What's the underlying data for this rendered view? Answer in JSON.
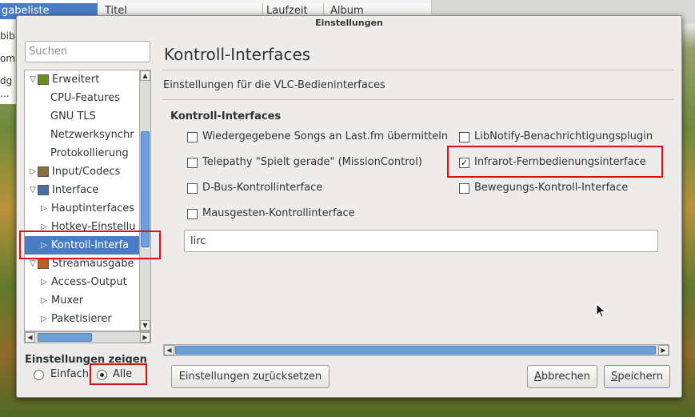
{
  "background_window": {
    "playlist_tab": "gabeliste",
    "sidebar_fragments": [
      "bib",
      "om",
      "dg",
      "..."
    ],
    "columns": [
      "Titel",
      "Laufzeit",
      "Album"
    ]
  },
  "dialog": {
    "title": "Einstellungen",
    "search_placeholder": "Suchen",
    "tree": [
      {
        "label": "Erweitert",
        "expander": "▽",
        "icon": "chip"
      },
      {
        "label": "CPU-Features"
      },
      {
        "label": "GNU TLS"
      },
      {
        "label": "Netzwerksynchr"
      },
      {
        "label": "Protokollierung"
      },
      {
        "label": "Input/Codecs",
        "expander": "▷",
        "icon": "codec"
      },
      {
        "label": "Interface",
        "expander": "▽",
        "icon": "interface"
      },
      {
        "label": "Hauptinterfaces",
        "expander": "▷"
      },
      {
        "label": "Hotkey-Einstellu",
        "expander": "▷"
      },
      {
        "label": "Kontroll-Interfa",
        "expander": "▷",
        "selected": true
      },
      {
        "label": "Streamausgabe",
        "expander": "▽",
        "icon": "stream"
      },
      {
        "label": "Access-Output",
        "expander": "▷"
      },
      {
        "label": "Muxer",
        "expander": "▷"
      },
      {
        "label": "Paketisierer",
        "expander": "▷"
      }
    ],
    "show_settings_label": "Einstellungen zeigen",
    "radio_simple": "Einfach",
    "radio_all": "Alle",
    "radio_selected": "Alle",
    "page_title": "Kontroll-Interfaces",
    "page_description": "Einstellungen für die VLC-Bedieninterfaces",
    "section_title": "Kontroll-Interfaces",
    "checkboxes": [
      {
        "label": "Wiedergegebene Songs an Last.fm übermitteln",
        "checked": false
      },
      {
        "label": "LibNotify-Benachrichtigungsplugin",
        "checked": false
      },
      {
        "label": "Telepathy \"Spielt gerade\" (MissionControl)",
        "checked": false
      },
      {
        "label": "Infrarot-Fernbedienungsinterface",
        "checked": true
      },
      {
        "label": "D-Bus-Kontrollinterface",
        "checked": false
      },
      {
        "label": "Bewegungs-Kontroll-Interface",
        "checked": false
      },
      {
        "label": "Mausgesten-Kontrollinterface",
        "checked": false
      }
    ],
    "interface_value": "lirc",
    "reset_button": {
      "pre": "Einstellungen zu",
      "mnemonic": "r",
      "post": "ücksetzen"
    },
    "cancel_button": {
      "mnemonic": "A",
      "post": "bbrechen"
    },
    "save_button": {
      "mnemonic": "S",
      "post": "peichern"
    },
    "check_mark": "✓",
    "highlight_color": "#e01010",
    "selection_color": "#4a7cc4"
  }
}
